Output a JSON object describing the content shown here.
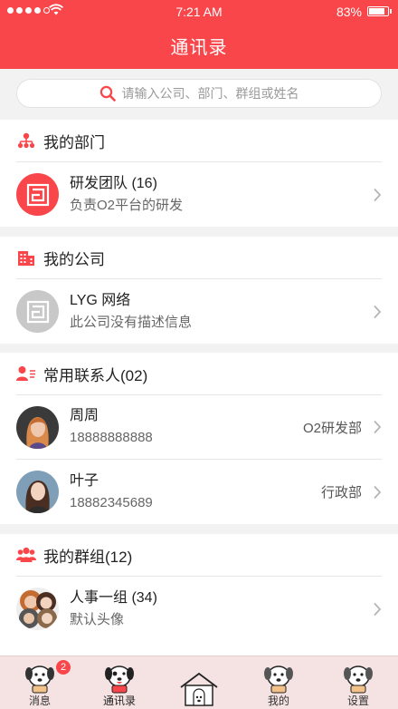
{
  "status_bar": {
    "time": "7:21 AM",
    "battery": "83%",
    "battery_level": 0.83
  },
  "header": {
    "title": "通讯录"
  },
  "search": {
    "placeholder": "请输入公司、部门、群组或姓名"
  },
  "sections": {
    "department": {
      "title": "我的部门",
      "items": [
        {
          "name": "研发团队 (16)",
          "subtitle": "负责O2平台的研发"
        }
      ]
    },
    "company": {
      "title": "我的公司",
      "items": [
        {
          "name": "LYG 网络",
          "subtitle": "此公司没有描述信息"
        }
      ]
    },
    "contacts": {
      "title": "常用联系人(02)",
      "items": [
        {
          "name": "周周",
          "phone": "18888888888",
          "dept": "O2研发部"
        },
        {
          "name": "叶子",
          "phone": "18882345689",
          "dept": "行政部"
        }
      ]
    },
    "groups": {
      "title": "我的群组(12)",
      "items": [
        {
          "name": "人事一组 (34)",
          "subtitle": "默认头像"
        }
      ]
    }
  },
  "tabbar": {
    "tabs": [
      {
        "label": "消息",
        "badge": "2"
      },
      {
        "label": "通讯录"
      },
      {
        "label": ""
      },
      {
        "label": "我的"
      },
      {
        "label": "设置"
      }
    ]
  },
  "colors": {
    "accent": "#f9464a",
    "tabbar_bg": "#f5e3e3"
  }
}
